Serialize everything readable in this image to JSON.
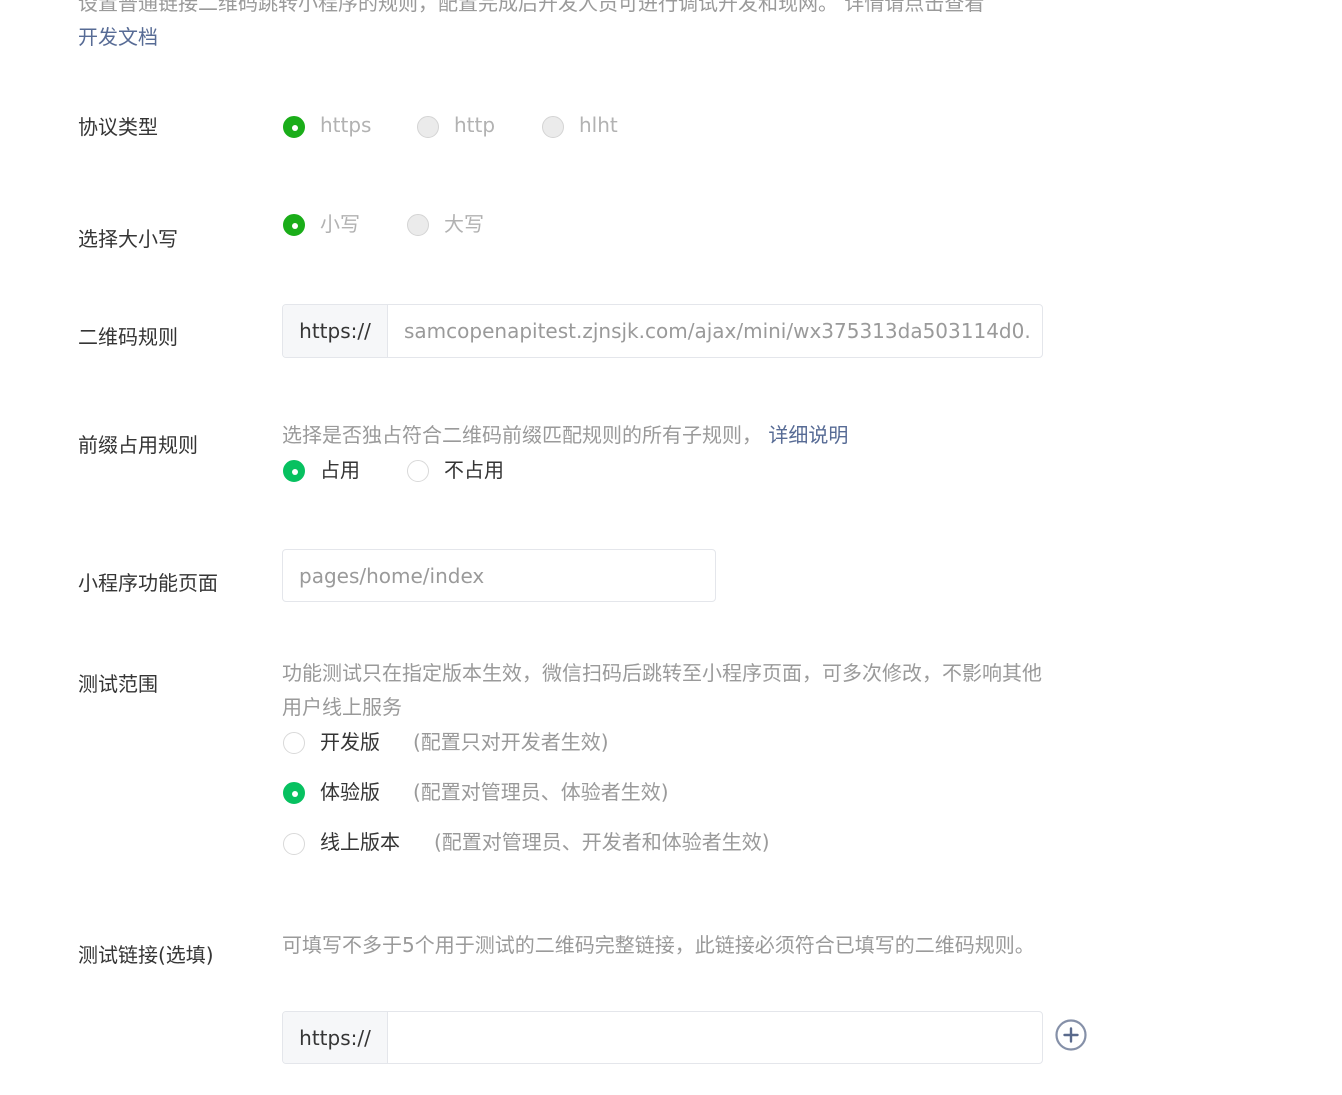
{
  "intro": {
    "text": "设置普通链接二维码跳转小程序的规则，配置完成后开发人员可进行调试开发和现网。 详情请点击查看",
    "doc_link": "开发文档"
  },
  "protocol": {
    "label": "协议类型",
    "options": [
      "https",
      "http",
      "hlht"
    ],
    "selected": "https"
  },
  "case": {
    "label": "选择大小写",
    "options": [
      "小写",
      "大写"
    ],
    "selected": "小写"
  },
  "qr_rule": {
    "label": "二维码规则",
    "prefix": "https://",
    "value": "samcopenapitest.zjnsjk.com/ajax/mini/wx375313da503114d0."
  },
  "prefix_rule": {
    "label": "前缀占用规则",
    "description": "选择是否独占符合二维码前缀匹配规则的所有子规则，",
    "detail_link": "详细说明",
    "options": [
      "占用",
      "不占用"
    ],
    "selected": "占用"
  },
  "page": {
    "label": "小程序功能页面",
    "value": "pages/home/index"
  },
  "test_scope": {
    "label": "测试范围",
    "description": "功能测试只在指定版本生效，微信扫码后跳转至小程序页面，可多次修改，不影响其他用户线上服务",
    "options": [
      {
        "label": "开发版",
        "note": "(配置只对开发者生效)"
      },
      {
        "label": "体验版",
        "note": "(配置对管理员、体验者生效)"
      },
      {
        "label": "线上版本",
        "note": "(配置对管理员、开发者和体验者生效)"
      }
    ],
    "selected": "体验版"
  },
  "test_link": {
    "label": "测试链接(选填)",
    "description": "可填写不多于5个用于测试的二维码完整链接，此链接必须符合已填写的二维码规则。",
    "prefix": "https://",
    "value": "",
    "add_icon": "plus-circle-icon"
  }
}
